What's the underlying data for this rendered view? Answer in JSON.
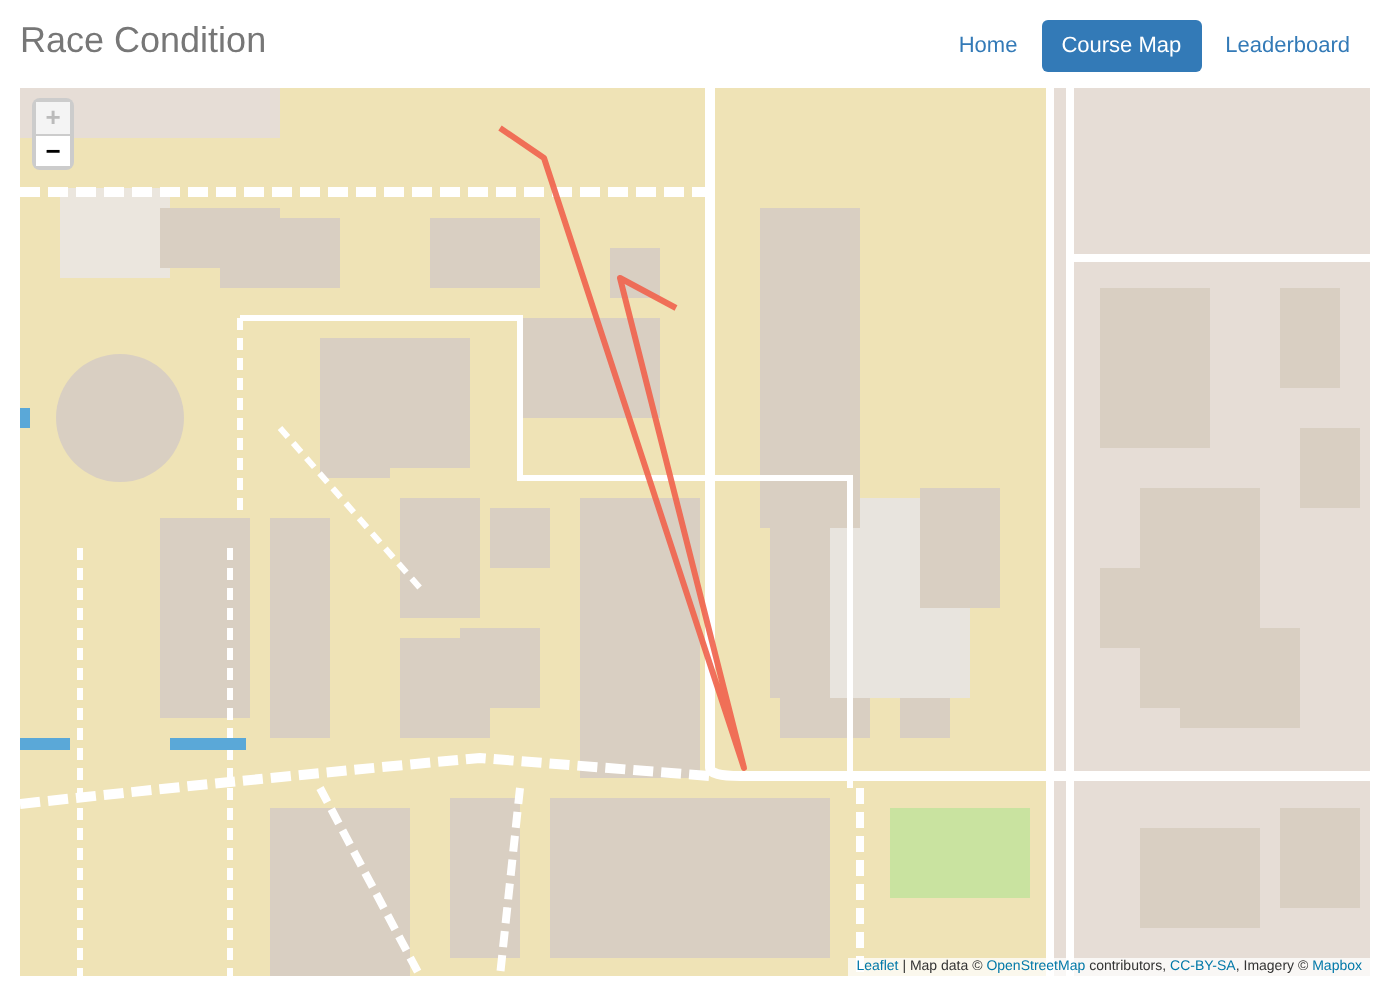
{
  "brand": "Race Condition",
  "nav": [
    {
      "label": "Home",
      "selected": false
    },
    {
      "label": "Course Map",
      "selected": true
    },
    {
      "label": "Leaderboard",
      "selected": false
    }
  ],
  "zoom_controls": [
    {
      "label": "+",
      "disabled": true
    },
    {
      "label": "−",
      "disabled": false
    }
  ],
  "attribution": [
    {
      "kind": "link",
      "text": "Leaflet"
    },
    {
      "kind": "text",
      "text": " | Map data © "
    },
    {
      "kind": "link",
      "text": "OpenStreetMap"
    },
    {
      "kind": "text",
      "text": " contributors, "
    },
    {
      "kind": "link",
      "text": "CC-BY-SA"
    },
    {
      "kind": "text",
      "text": ", Imagery © "
    },
    {
      "kind": "link",
      "text": "Mapbox"
    }
  ]
}
